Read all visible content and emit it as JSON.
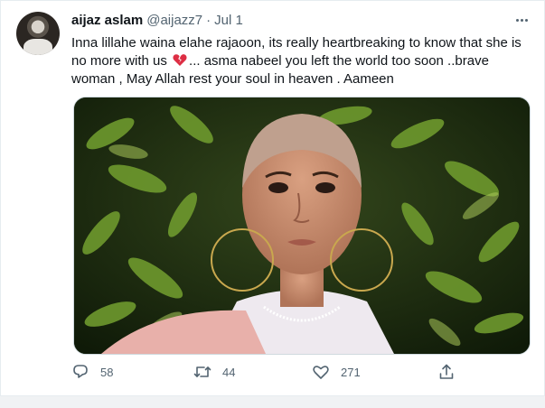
{
  "tweet": {
    "author_name": "aijaz aslam",
    "handle": "@aijazz7",
    "separator": "·",
    "date": "Jul 1",
    "text_before_emoji": "Inna lillahe waina elahe rajaoon, its really heartbreaking to know that she is no more with us ",
    "emoji": "broken-heart-emoji",
    "text_after_emoji": "... asma nabeel you left the world too soon ..brave woman , May Allah rest your soul in heaven . Aameen",
    "replies": "58",
    "retweets": "44",
    "likes": "271"
  },
  "icons": {
    "more": "more-options-icon",
    "reply": "reply-icon",
    "retweet": "retweet-icon",
    "like": "like-icon",
    "share": "share-icon"
  },
  "colors": {
    "text": "#0f1419",
    "muted": "#536471",
    "emoji_red": "#dd2e44"
  }
}
